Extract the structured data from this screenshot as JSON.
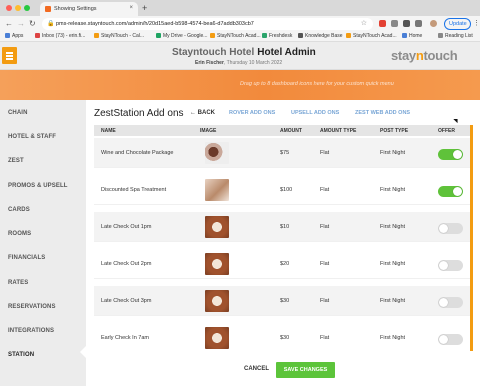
{
  "browser": {
    "tab_title": "Showing Settings",
    "tab_close": "×",
    "new_tab": "+",
    "url": "pms-release.stayntouch.com/admin/h/20d15aed-b598-4574-bea6-d7addb303cb7",
    "update_label": "Update",
    "bookmarks": [
      "Apps",
      "Inbox (73) - erin.fi...",
      "StayNTouch - Cal...",
      "My Drive - Google...",
      "StayNTouch Acad...",
      "Freshdesk",
      "Knowledge Base",
      "StayNTouch Acad...",
      "Home"
    ],
    "reading_list": "Reading List"
  },
  "header": {
    "hotel_name": "Stayntouch Hotel",
    "section": "Hotel Admin",
    "user_name": "Erin Fischer",
    "date": "Thursday 10 March 2022",
    "logo_pre": "stay",
    "logo_n": "n",
    "logo_post": "touch"
  },
  "banner": {
    "hint": "Drag up to 8 dashboard icons here for your custom quick menu"
  },
  "sidebar": {
    "items": [
      "CHAIN",
      "HOTEL & STAFF",
      "ZEST",
      "PROMOS & UPSELL",
      "CARDS",
      "ROOMS",
      "FINANCIALS",
      "RATES",
      "RESERVATIONS",
      "INTEGRATIONS",
      "STATION"
    ],
    "active": "STATION"
  },
  "page": {
    "title": "ZestStation Add ons",
    "back_label": "BACK",
    "links": [
      "ROVER ADD ONS",
      "UPSELL ADD ONS",
      "ZEST WEB ADD ONS"
    ]
  },
  "table": {
    "columns": [
      "NAME",
      "IMAGE",
      "AMOUNT",
      "AMOUNT TYPE",
      "POST TYPE",
      "OFFER"
    ],
    "rows": [
      {
        "name": "Wine and Chocolate Package",
        "amount": "$75",
        "amount_type": "Flat",
        "post_type": "First Night",
        "offer": true
      },
      {
        "name": "Discounted Spa Treatment",
        "amount": "$100",
        "amount_type": "Flat",
        "post_type": "First Night",
        "offer": true
      },
      {
        "name": "Late Check Out 1pm",
        "amount": "$10",
        "amount_type": "Flat",
        "post_type": "First Night",
        "offer": false
      },
      {
        "name": "Late Check Out 2pm",
        "amount": "$20",
        "amount_type": "Flat",
        "post_type": "First Night",
        "offer": false
      },
      {
        "name": "Late Check Out 3pm",
        "amount": "$30",
        "amount_type": "Flat",
        "post_type": "First Night",
        "offer": false
      },
      {
        "name": "Early Check In 7am",
        "amount": "$30",
        "amount_type": "Flat",
        "post_type": "First Night",
        "offer": false
      }
    ]
  },
  "footer": {
    "cancel_label": "CANCEL",
    "save_label": "SAVE CHANGES"
  },
  "colors": {
    "accent_orange": "#f39c12",
    "toggle_on": "#5fc23a",
    "link_blue": "#7aa7d6"
  }
}
